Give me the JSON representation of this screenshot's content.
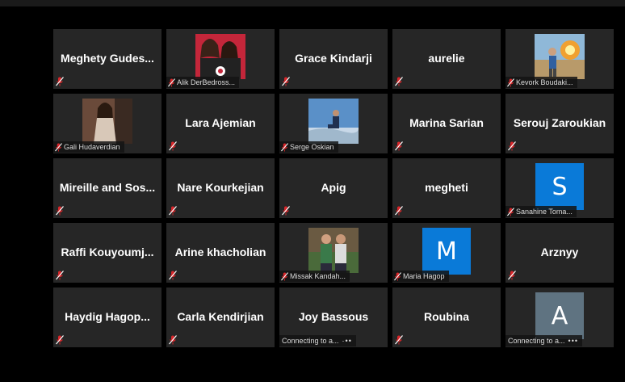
{
  "colors": {
    "tile_bg": "#262626",
    "mute_red": "#d7262a",
    "avatar_blue": "#0a7ad8",
    "avatar_gray": "#5f7381"
  },
  "participants": [
    {
      "name": "Meghety  Gudes...",
      "muted": true
    },
    {
      "name": "Alik DerBedross...",
      "muted": true,
      "video": true
    },
    {
      "name": "Grace Kindarji",
      "muted": true
    },
    {
      "name": "aurelie",
      "muted": true
    },
    {
      "name": "Kevork Boudaki...",
      "muted": true,
      "video": true
    },
    {
      "name": "Gali Hudaverdian",
      "muted": true,
      "video": true
    },
    {
      "name": "Lara Ajemian",
      "muted": true
    },
    {
      "name": "Serge Oskian",
      "muted": true,
      "video": true
    },
    {
      "name": "Marina Sarian",
      "muted": true
    },
    {
      "name": "Serouj Zaroukian",
      "muted": true
    },
    {
      "name": "Mireille and Sos...",
      "muted": true
    },
    {
      "name": "Nare Kourkejian",
      "muted": true
    },
    {
      "name": "Apig",
      "muted": true
    },
    {
      "name": "megheti",
      "muted": true
    },
    {
      "name": "Sanahine Toma...",
      "muted": true,
      "avatar_letter": "S"
    },
    {
      "name": "Raffi  Kouyoumj...",
      "muted": true
    },
    {
      "name": "Arine khacholian",
      "muted": true
    },
    {
      "name": "Missak Kandah...",
      "muted": true,
      "video": true
    },
    {
      "name": "Maria Hagop",
      "muted": true,
      "avatar_letter": "M"
    },
    {
      "name": "Arznyy",
      "muted": true
    },
    {
      "name": "Haydig  Hagop...",
      "muted": true
    },
    {
      "name": "Carla Kendirjian",
      "muted": true
    },
    {
      "name": "Joy Bassous",
      "status": "Connecting to a..."
    },
    {
      "name": "Roubina",
      "muted": true
    },
    {
      "name": "A",
      "status": "Connecting to a...",
      "avatar_letter": "A"
    }
  ]
}
